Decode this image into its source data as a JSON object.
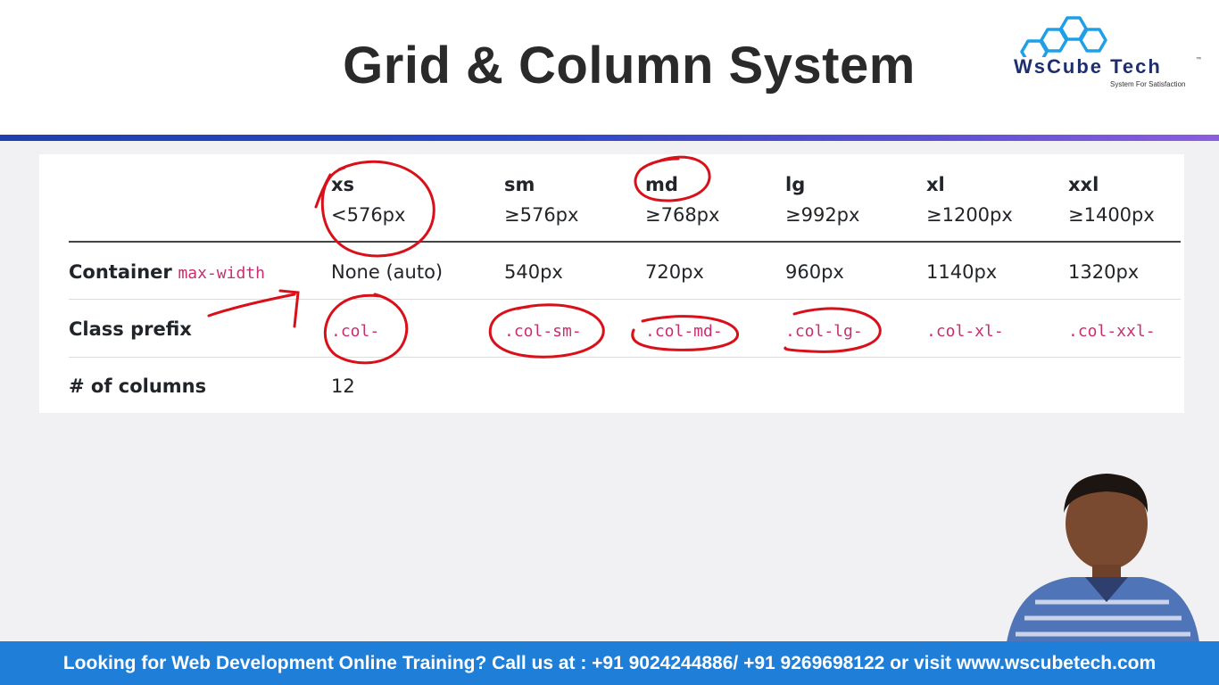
{
  "slide": {
    "title": "Grid & Column System"
  },
  "logo": {
    "name": "WsCube Tech",
    "tm": "™",
    "tagline": "System For Satisfaction"
  },
  "table": {
    "breakpoints": [
      {
        "name": "xs",
        "width": "<576px"
      },
      {
        "name": "sm",
        "width": "≥576px"
      },
      {
        "name": "md",
        "width": "≥768px"
      },
      {
        "name": "lg",
        "width": "≥992px"
      },
      {
        "name": "xl",
        "width": "≥1200px"
      },
      {
        "name": "xxl",
        "width": "≥1400px"
      }
    ],
    "rows": {
      "container": {
        "label": "Container",
        "label_code": "max-width",
        "values": [
          "None (auto)",
          "540px",
          "720px",
          "960px",
          "1140px",
          "1320px"
        ]
      },
      "class_prefix": {
        "label": "Class prefix",
        "values": [
          ".col-",
          ".col-sm-",
          ".col-md-",
          ".col-lg-",
          ".col-xl-",
          ".col-xxl-"
        ]
      },
      "columns": {
        "label": "# of columns",
        "value": "12"
      }
    }
  },
  "footer": {
    "text": "Looking for Web Development Online Training? Call us at : +91 9024244886/ +91 9269698122 or visit www.wscubetech.com"
  },
  "colors": {
    "accent_bar": "#2747c4",
    "footer_bg": "#1f7ed8",
    "code_pink": "#c72f6e",
    "annotation_red": "#d9101a"
  }
}
